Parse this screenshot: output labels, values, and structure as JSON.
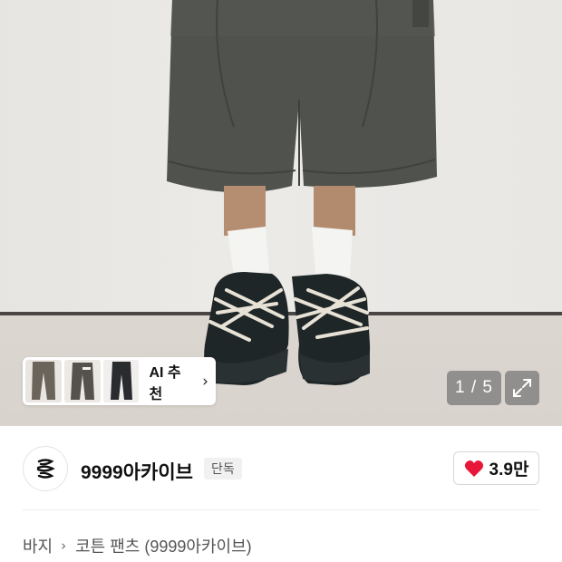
{
  "product_image": {
    "description_icon": "product-photo",
    "counter": "1 / 5",
    "expand_icon": "expand-icon"
  },
  "ai_recommend": {
    "label": "AI 추천",
    "chevron_icon": "chevron-right-icon"
  },
  "seller": {
    "name": "9999아카이브",
    "badge": "단독",
    "logo_icon": "brand-logo-icon"
  },
  "like": {
    "count": "3.9만",
    "icon": "heart-icon",
    "color": "#e8173a"
  },
  "breadcrumb": {
    "category": "바지",
    "separator_icon": "chevron-right-icon",
    "product": "코튼 팬츠 (9999아카이브)"
  }
}
